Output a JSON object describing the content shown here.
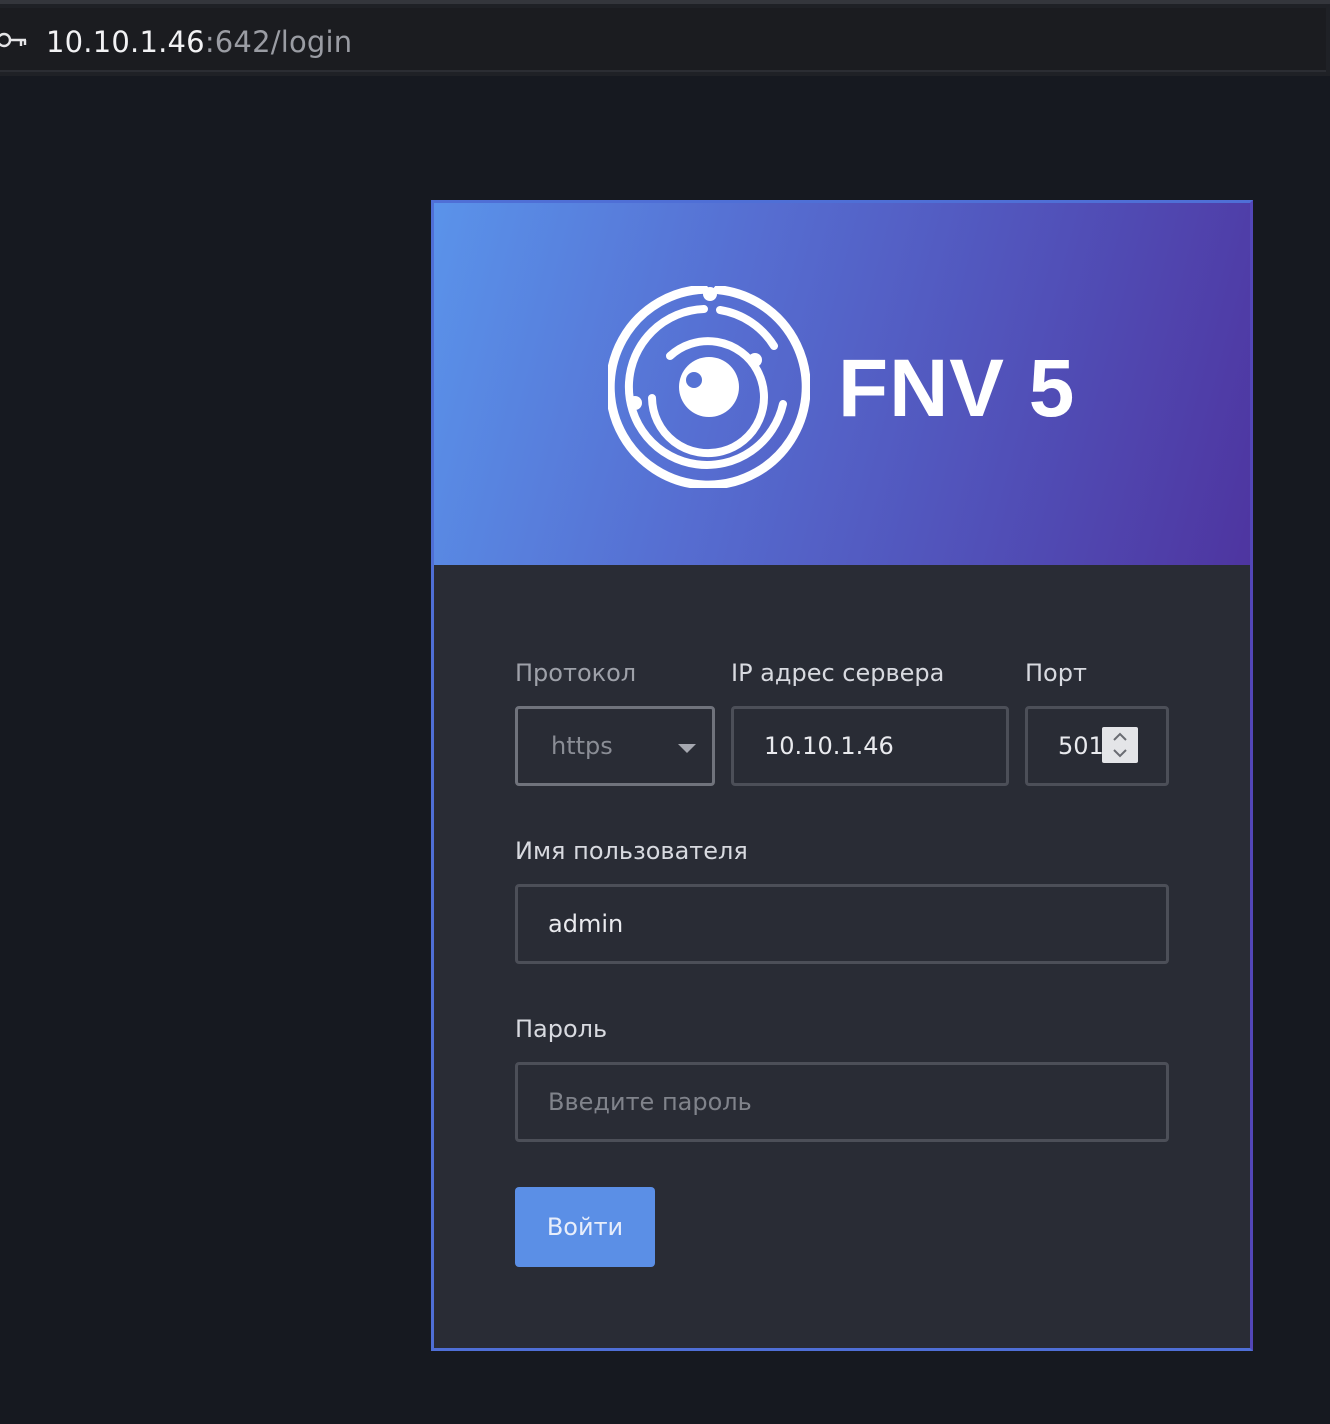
{
  "browser": {
    "url_host": "10.10.1.46",
    "url_rest": ":642/login",
    "security_icon": "key-icon"
  },
  "header": {
    "logo_icon": "fnv-eye-logo-icon",
    "brand": "FNV 5"
  },
  "form": {
    "protocol": {
      "label": "Протокол",
      "value": "https"
    },
    "server_ip": {
      "label": "IP адрес сервера",
      "value": "10.10.1.46"
    },
    "port": {
      "label": "Порт",
      "value": "501"
    },
    "username": {
      "label": "Имя пользователя",
      "value": "admin"
    },
    "password": {
      "label": "Пароль",
      "placeholder": "Введите пароль",
      "value": ""
    },
    "submit_label": "Войти"
  },
  "colors": {
    "page_background": "#161920",
    "card_background": "#292c35",
    "gradient_start": "#5a93ea",
    "gradient_end": "#4e35a0",
    "button": "#5b8fe6"
  }
}
